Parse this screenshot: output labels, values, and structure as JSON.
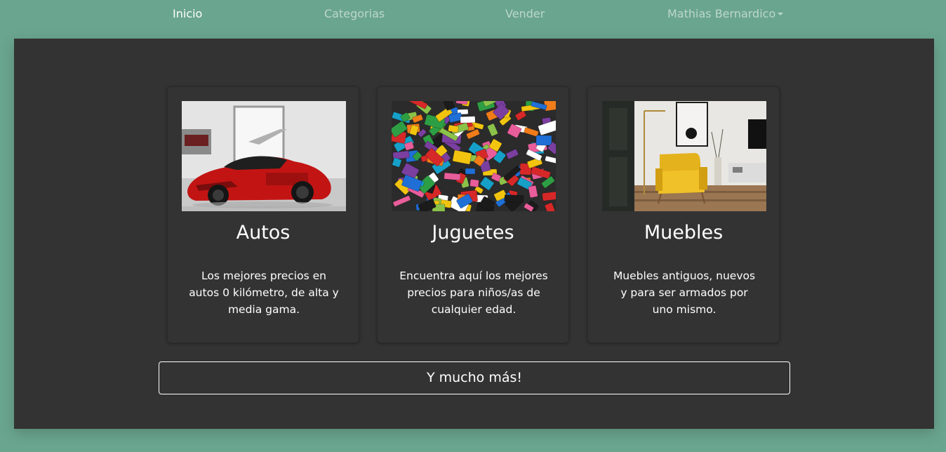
{
  "nav": {
    "items": [
      {
        "label": "Inicio",
        "active": true
      },
      {
        "label": "Categorias",
        "active": false
      },
      {
        "label": "Vender",
        "active": false
      },
      {
        "label": "Mathias Bernardico",
        "active": false,
        "dropdown": true
      }
    ]
  },
  "cards": [
    {
      "title": "Autos",
      "text": "Los mejores precios en autos 0 kilómetro, de alta y media gama.",
      "image": "red-sports-car-photo"
    },
    {
      "title": "Juguetes",
      "text": "Encuentra aquí los mejores precios para niños/as de cualquier edad.",
      "image": "colorful-toy-bricks-photo"
    },
    {
      "title": "Muebles",
      "text": "Muebles antiguos, nuevos y para ser armados por uno mismo.",
      "image": "yellow-armchair-room-photo"
    }
  ],
  "more_button": {
    "label": "Y mucho más!"
  },
  "colors": {
    "background": "#6aa58f",
    "panel": "#333333",
    "text": "#ffffff"
  }
}
